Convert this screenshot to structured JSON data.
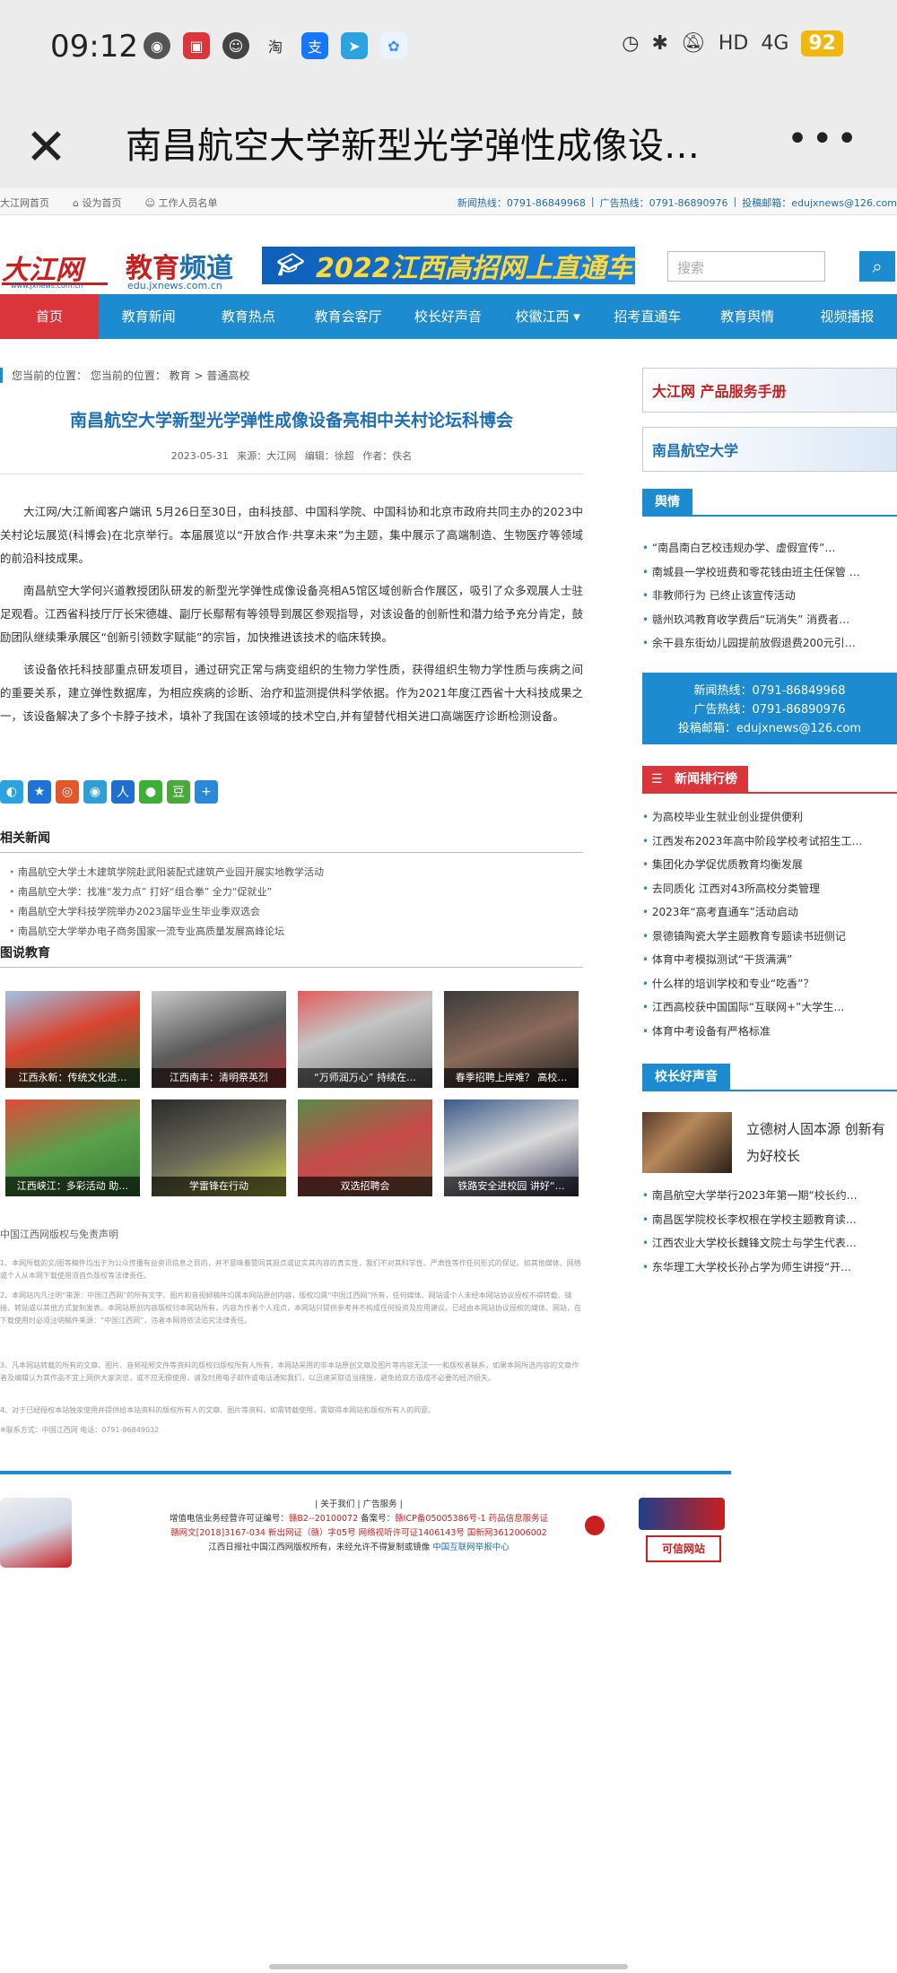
{
  "status": {
    "time": "09:12",
    "network": "4G",
    "battery": "92",
    "hd": "HD"
  },
  "nav": {
    "title": "南昌航空大学新型光学弹性成像设…",
    "close": "✕",
    "more": "•••"
  },
  "topbar": {
    "home": "大江网首页",
    "sethome": "设为首页",
    "staff": "工作人员名单",
    "news_hotline": "新闻热线：0791-86849968",
    "ad_hotline": "广告热线：0791-86890976",
    "email": "投稿邮箱：edujxnews@126.com"
  },
  "header": {
    "logo1": "大江网",
    "logo1_url": "www.jxnews.com.cn",
    "logo2_a": "教育",
    "logo2_b": "频道",
    "logo2_url": "edu.jxnews.com.cn",
    "banner": "2022江西高招网上直通车",
    "search_placeholder": "搜索"
  },
  "menu": [
    "首页",
    "教育新闻",
    "教育热点",
    "教育会客厅",
    "校长好声音",
    "校徽江西 ▾",
    "招考直通车",
    "教育舆情",
    "视频播报"
  ],
  "article": {
    "crumb": "您当前的位置：   您当前的位置：  教育 > 普通高校",
    "title": "南昌航空大学新型光学弹性成像设备亮相中关村论坛科博会",
    "date": "2023-05-31",
    "source": "来源：大江网",
    "editor": "编辑：徐超",
    "author": "作者：佚名",
    "p1": "大江网/大江新闻客户端讯 5月26日至30日，由科技部、中国科学院、中国科协和北京市政府共同主办的2023中关村论坛展览(科博会)在北京举行。本届展览以“开放合作·共享未来”为主题，集中展示了高端制造、生物医疗等领域的前沿科技成果。",
    "p2": "南昌航空大学何兴道教授团队研发的新型光学弹性成像设备亮相A5馆区域创新合作展区，吸引了众多观展人士驻足观看。江西省科技厅厅长宋德雄、副厅长鄢帮有等领导到展区参观指导，对该设备的创新性和潜力给予充分肯定，鼓励团队继续秉承展区“创新引领数字赋能”的宗旨，加快推进该技术的临床转换。",
    "p3": "该设备依托科技部重点研发项目，通过研究正常与病变组织的生物力学性质，获得组织生物力学性质与疾病之间的重要关系，建立弹性数据库，为相应疾病的诊断、治疗和监测提供科学依据。作为2021年度江西省十大科技成果之一，该设备解决了多个卡脖子技术，填补了我国在该领域的技术空白,并有望替代相关进口高端医疗诊断检测设备。"
  },
  "related": {
    "heading": "相关新闻",
    "items": [
      "南昌航空大学土木建筑学院赴武阳装配式建筑产业园开展实地教学活动",
      "南昌航空大学：找准“发力点” 打好“组合拳” 全力“促就业”",
      "南昌航空大学科技学院举办2023届毕业生毕业季双选会",
      "南昌航空大学举办电子商务国家一流专业高质量发展高峰论坛"
    ]
  },
  "pictures": {
    "heading": "图说教育",
    "items": [
      "江西永新：传统文化进…",
      "江西南丰：清明祭英烈",
      "“万师润万心” 持续在…",
      "春季招聘上岸难？ 高校…",
      "江西峡江：多彩活动 助…",
      "学雷锋在行动",
      "双选招聘会",
      "铁路安全进校园 讲好“…"
    ]
  },
  "copyright": {
    "heading": "中国江西网版权与免责声明",
    "lines": [
      "1、本网所载的文/图等稿件均出于为公众传播有益资讯信息之目的，并不意味着赞同其观点或证实其内容的真实性，我们不对其科学性、严肃性等作任何形式的保证。如其他媒体、网络或个人从本网下载使用须自负版权等法律责任。",
      "2、本网站内凡注明“来源：中国江西网”的所有文字、图片和音视频稿件均属本网站原创内容，版权均属“中国江西网”所有，任何媒体、网站或个人未经本网站协议授权不得转载、链接、转贴或以其他方式复制发表。本网站原创内容版权归本网站所有，内容为作者个人观点，本网站只提供参考并不构成任何投资及应用建议。已经由本网站协议授权的媒体、网站，在下载使用时必须注明稿件来源：“中国江西网”，违者本网将依法追究法律责任。",
      "3、凡本网站转载的所有的文章、图片、音频视频文件等资料的版权归版权所有人所有，本网站采用的非本站原创文章及图片等内容无法一一和版权者联系，如果本网所选内容的文章作者及编辑认为其作品不宜上网供大家浏览，或不应无偿使用，请及时用电子邮件或电话通知我们，以迅速采取适当措施，避免给双方造成不必要的经济损失。",
      "4、对于已经授权本站独家使用并提供给本站资料的版权所有人的文章、图片等资料，如需转载使用，需取得本网站和版权所有人的同意。"
    ],
    "contact": "※联系方式：中国江西网   电话：0791-86849032"
  },
  "footer": {
    "links": "| 关于我们 | 广告服务 |",
    "line1a": "增值电信业务经营许可证编号：",
    "line1b": "赣B2--20100072",
    "line1c": " 备案号：",
    "line1d": "赣ICP备05005386号-1 药品信息服务证",
    "line2": "赣网文[2018]3167-034   新出网证（赣）字05号   网络视听许可证1406143号 国新网3612006002",
    "line3a": "江西日报社中国江西网版权所有，未经允许不得复制或镜像 ",
    "line3b": "中国互联网举报中心",
    "badge": "可信网站"
  },
  "sidebar": {
    "ad1": "大江网 产品服务手册",
    "ad2": "南昌航空大学",
    "yuqing_tag": "舆情",
    "yuqing": [
      "“南昌南白艺校违规办学、虚假宣传”…",
      "南城县一学校班费和零花钱由班主任保管 …",
      "非教师行为 已终止该宣传活动",
      "赣州玖鸿教育收学费后“玩消失” 消费者…",
      "余干县东街幼儿园提前放假退费200元引…"
    ],
    "hotline1": "新闻热线：0791-86849968",
    "hotline2": "广告热线：0791-86890976",
    "hotline3": "投稿邮箱：edujxnews@126.com",
    "rank_tag": "新闻排行榜",
    "rank": [
      "为高校毕业生就业创业提供便利",
      "江西发布2023年高中阶段学校考试招生工…",
      "集团化办学促优质教育均衡发展",
      "去同质化 江西对43所高校分类管理",
      "2023年“高考直通车”活动启动",
      "景德镇陶瓷大学主题教育专题读书班侧记",
      "体育中考模拟测试“干货满满”",
      "什么样的培训学校和专业“吃香”？",
      "江西高校获中国国际“互联网+”大学生…",
      "体育中考设备有严格标准"
    ],
    "principal_tag": "校长好声音",
    "principal_feature": "立德树人固本源 创新有为好校长",
    "principal": [
      "南昌航空大学举行2023年第一期“校长约…",
      "南昌医学院校长李权根在学校主题教育读…",
      "江西农业大学校长魏锋文院士与学生代表…",
      "东华理工大学校长孙占学为师生讲授“开…"
    ]
  },
  "colors": {
    "accent": "#1d8bd0",
    "red": "#d9353a"
  }
}
